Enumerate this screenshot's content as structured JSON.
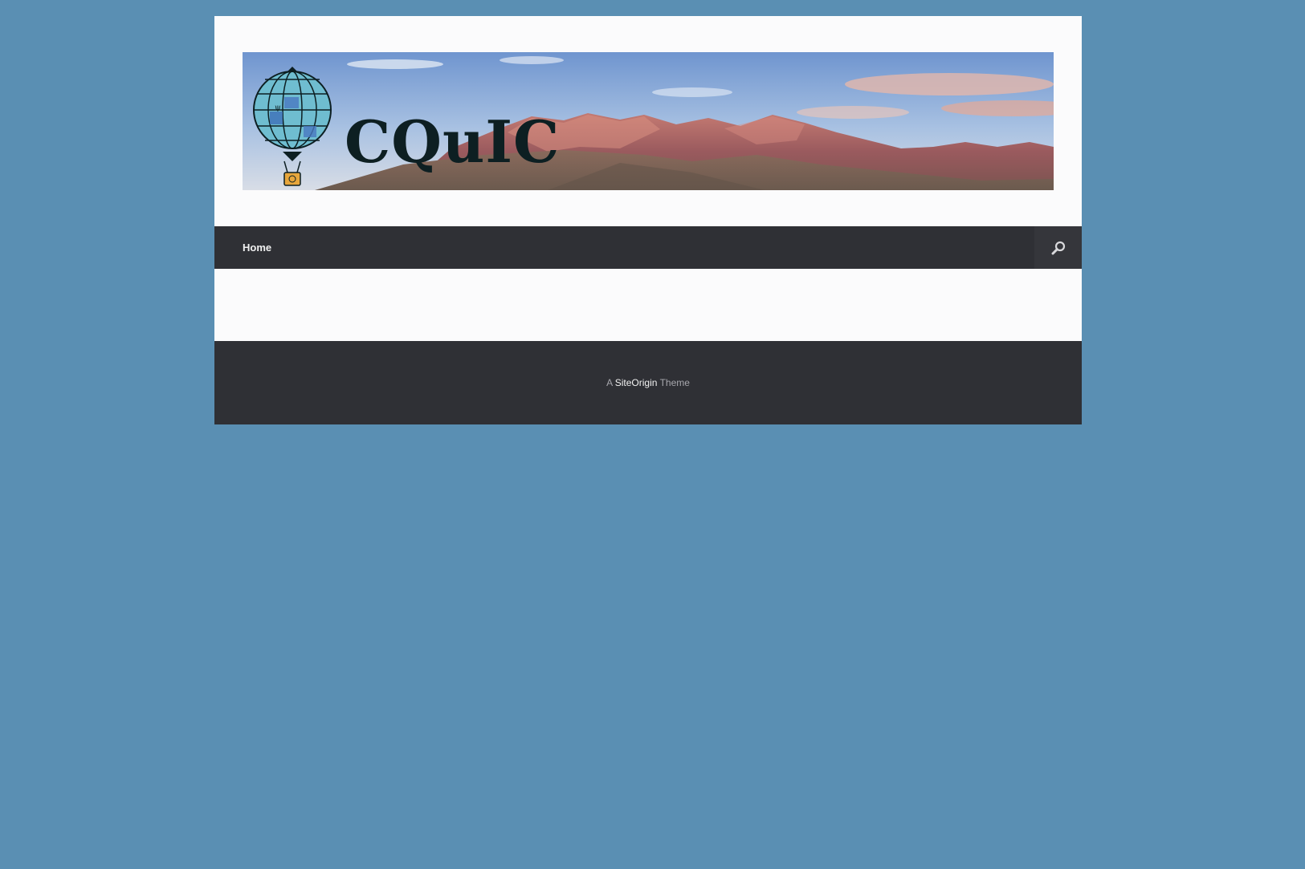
{
  "site": {
    "logo_text": "CQuIC",
    "banner_alt": "CQuIC header banner with balloon logo and mountain panorama",
    "balloon_psi": "ψ"
  },
  "nav": {
    "items": [
      {
        "label": "Home"
      }
    ],
    "search_icon": "search-icon"
  },
  "footer": {
    "prefix": "A",
    "link_label": "SiteOrigin",
    "suffix": "Theme"
  },
  "colors": {
    "page_background": "#5a8fb3",
    "container_background": "#fbfbfc",
    "nav_background": "#2f3035",
    "footer_background": "#2f3035",
    "logo_text": "#0d1f22"
  }
}
